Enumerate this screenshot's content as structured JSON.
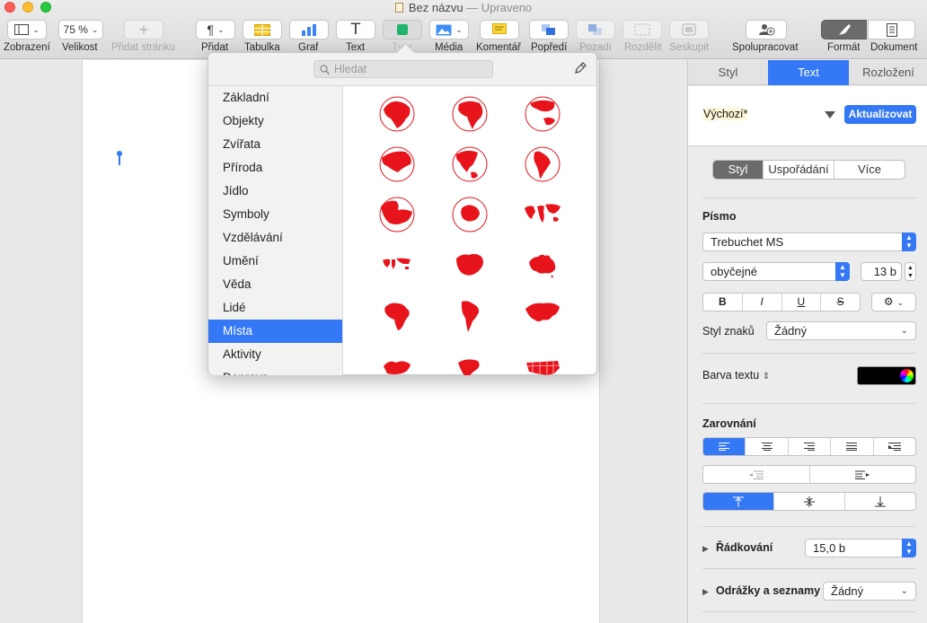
{
  "window": {
    "title": "Bez názvu",
    "status": "— Upraveno"
  },
  "toolbar": {
    "zoom_value": "75 %",
    "items": [
      {
        "label": "Zobrazení"
      },
      {
        "label": "Velikost"
      },
      {
        "label": "Přidat stránku"
      },
      {
        "label": "Přidat"
      },
      {
        "label": "Tabulka"
      },
      {
        "label": "Graf"
      },
      {
        "label": "Text"
      },
      {
        "label": "Tvar"
      },
      {
        "label": "Média"
      },
      {
        "label": "Komentář"
      },
      {
        "label": "Popředí"
      },
      {
        "label": "Pozadí"
      },
      {
        "label": "Rozdělit"
      },
      {
        "label": "Seskupit"
      },
      {
        "label": "Spolupracovat"
      },
      {
        "label": "Formát"
      },
      {
        "label": "Dokument"
      }
    ]
  },
  "shapes_popover": {
    "search_placeholder": "Hledat",
    "categories": [
      "Základní",
      "Objekty",
      "Zvířata",
      "Příroda",
      "Jídlo",
      "Symboly",
      "Vzdělávání",
      "Umění",
      "Věda",
      "Lidé",
      "Místa",
      "Aktivity",
      "Doprava"
    ],
    "selected_category": "Místa",
    "shape_color": "#e8141c"
  },
  "inspector": {
    "tabs": [
      "Styl",
      "Text",
      "Rozložení"
    ],
    "active_tab": "Text",
    "paragraph_style": "Výchozí*",
    "update_button": "Aktualizovat",
    "subtabs": [
      "Styl",
      "Uspořádání",
      "Více"
    ],
    "font_section": "Písmo",
    "font_family": "Trebuchet MS",
    "font_weight": "obyčejné",
    "font_size": "13 b",
    "bold": "B",
    "italic": "I",
    "underline": "U",
    "strike": "S",
    "char_style_label": "Styl znaků",
    "char_style_value": "Žádný",
    "text_color_label": "Barva textu",
    "text_color": "#000000",
    "alignment_section": "Zarovnání",
    "line_spacing_label": "Řádkování",
    "line_spacing_value": "15,0 b",
    "bullets_label": "Odrážky a seznamy",
    "bullets_value": "Žádný",
    "accent": "#3478f6"
  }
}
